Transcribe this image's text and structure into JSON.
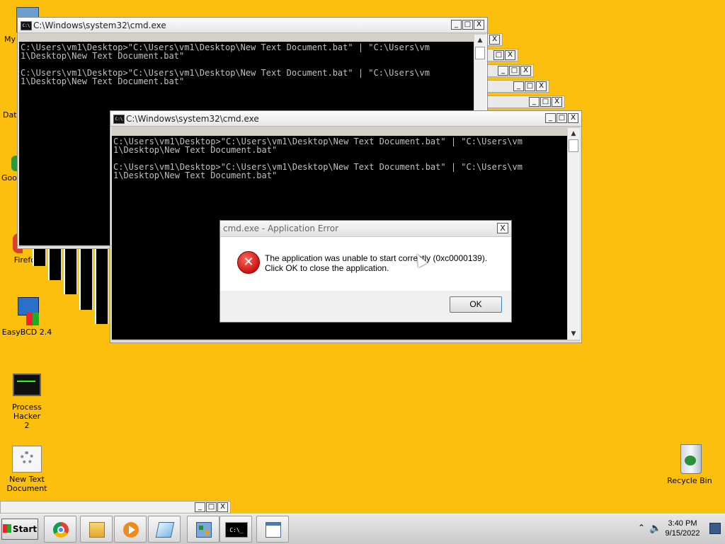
{
  "desktop": {
    "icons": {
      "my_computer": "My",
      "data": "Data",
      "google": "Goo",
      "firefox": "Firefox",
      "easybcd": "EasyBCD 2.4",
      "process_hacker_1": "Process Hacker",
      "process_hacker_2": "2",
      "new_text_1": "New Text",
      "new_text_2": "Document",
      "recycle_bin": "Recycle Bin"
    }
  },
  "back_window": {
    "title": "C:\\Windows\\system32\\cmd.exe",
    "console": "C:\\Users\\vm1\\Desktop>\"C:\\Users\\vm1\\Desktop\\New Text Document.bat\" | \"C:\\Users\\vm\n1\\Desktop\\New Text Document.bat\"\n\nC:\\Users\\vm1\\Desktop>\"C:\\Users\\vm1\\Desktop\\New Text Document.bat\" | \"C:\\Users\\vm\n1\\Desktop\\New Text Document.bat\""
  },
  "front_window": {
    "title": "C:\\Windows\\system32\\cmd.exe",
    "console": "C:\\Users\\vm1\\Desktop>\"C:\\Users\\vm1\\Desktop\\New Text Document.bat\" | \"C:\\Users\\vm\n1\\Desktop\\New Text Document.bat\"\n\nC:\\Users\\vm1\\Desktop>\"C:\\Users\\vm1\\Desktop\\New Text Document.bat\" | \"C:\\Users\\vm\n1\\Desktop\\New Text Document.bat\""
  },
  "window_buttons": {
    "minimize": "_",
    "maximize": "□",
    "close": "X"
  },
  "dialog": {
    "title": "cmd.exe - Application Error",
    "message": "The application was unable to start correctly (0xc0000139). Click OK to close the application.",
    "ok_label": "OK",
    "close_label": "X",
    "icon_glyph": "✕"
  },
  "taskbar": {
    "start_label": "Start",
    "cmd_glyph": "C:\\_",
    "time": "3:40 PM",
    "date": "9/15/2022"
  },
  "colors": {
    "desktop": "#fcbf0e",
    "console": "#000000",
    "error": "#c91414"
  }
}
